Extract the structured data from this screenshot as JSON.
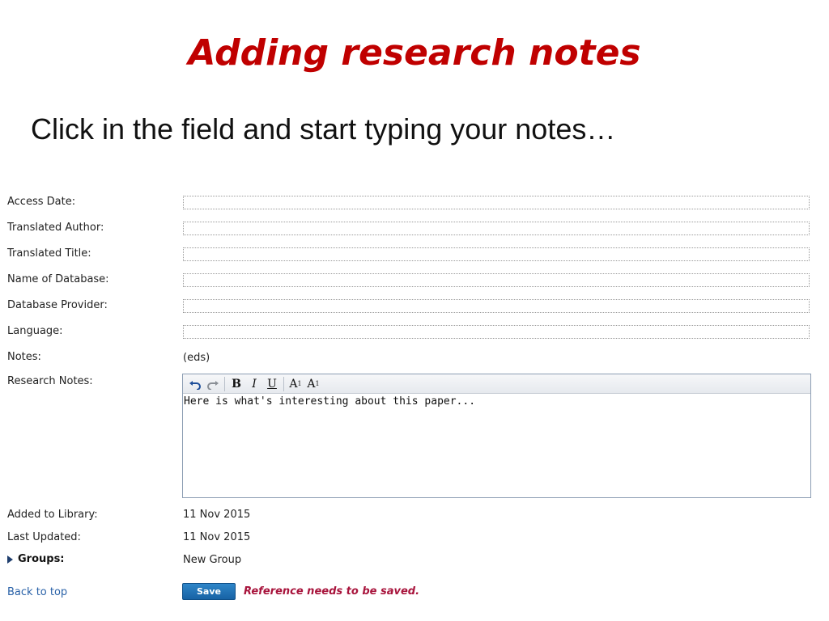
{
  "slide": {
    "title": "Adding research notes",
    "subtitle": "Click in the field and start typing your notes…"
  },
  "form": {
    "fields": [
      {
        "label": "Access Date:",
        "value": ""
      },
      {
        "label": "Translated Author:",
        "value": ""
      },
      {
        "label": "Translated Title:",
        "value": ""
      },
      {
        "label": "Name of Database:",
        "value": ""
      },
      {
        "label": "Database Provider:",
        "value": ""
      },
      {
        "label": "Language:",
        "value": ""
      }
    ],
    "notes": {
      "label": "Notes:",
      "value": "(eds)"
    },
    "research_notes": {
      "label": "Research Notes:",
      "text": "Here is what's interesting about this paper...",
      "toolbar": {
        "undo_icon": "undo-icon",
        "redo_icon": "redo-icon",
        "bold": "B",
        "italic": "I",
        "underline": "U",
        "subscript_base": "A",
        "subscript_mark": "1",
        "superscript_base": "A",
        "superscript_mark": "1"
      }
    },
    "added_to_library": {
      "label": "Added to Library:",
      "value": "11 Nov 2015"
    },
    "last_updated": {
      "label": "Last Updated:",
      "value": "11 Nov 2015"
    },
    "groups": {
      "label": "Groups:",
      "value": "New Group"
    },
    "back_to_top": "Back to top",
    "save_label": "Save",
    "save_warning": "Reference needs to be saved."
  },
  "colors": {
    "title": "#c00000",
    "link": "#2a62a8",
    "save_button": "#1762a4",
    "warning": "#a8143c"
  }
}
